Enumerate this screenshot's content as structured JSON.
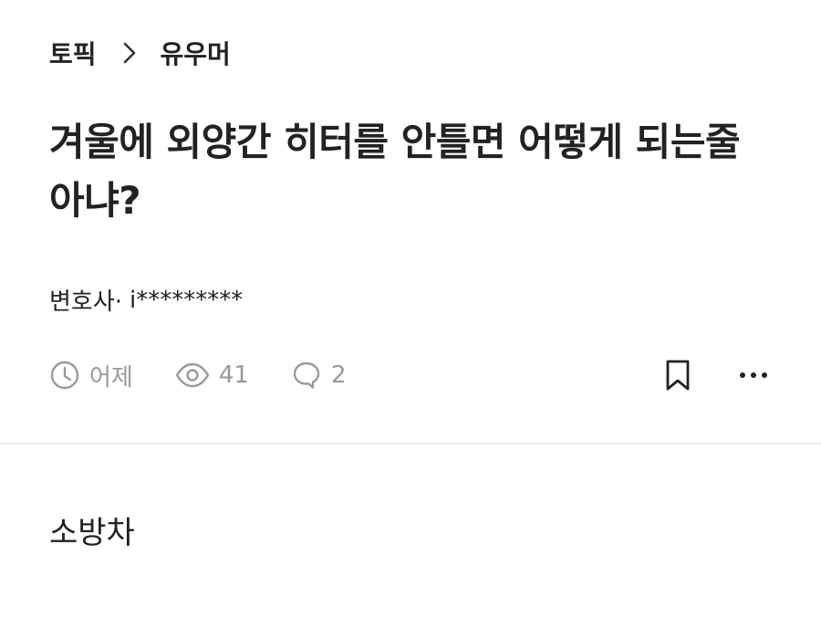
{
  "breadcrumb": {
    "parent": "토픽",
    "current": "유우머"
  },
  "post": {
    "title": "겨울에 외양간 히터를 안틀면 어떻게 되는줄 아냐?",
    "author_company": "변호사·",
    "author_id": "i*********",
    "time": "어제",
    "views": "41",
    "comments": "2",
    "body": "소방차"
  },
  "icons": {
    "breadcrumb_separator": "chevron-right-icon",
    "time": "clock-icon",
    "views": "eye-icon",
    "comments": "comment-icon",
    "bookmark": "bookmark-icon",
    "more": "more-horizontal-icon"
  },
  "colors": {
    "text": "#222222",
    "meta": "#9a9a9a",
    "divider": "#ebebeb"
  }
}
